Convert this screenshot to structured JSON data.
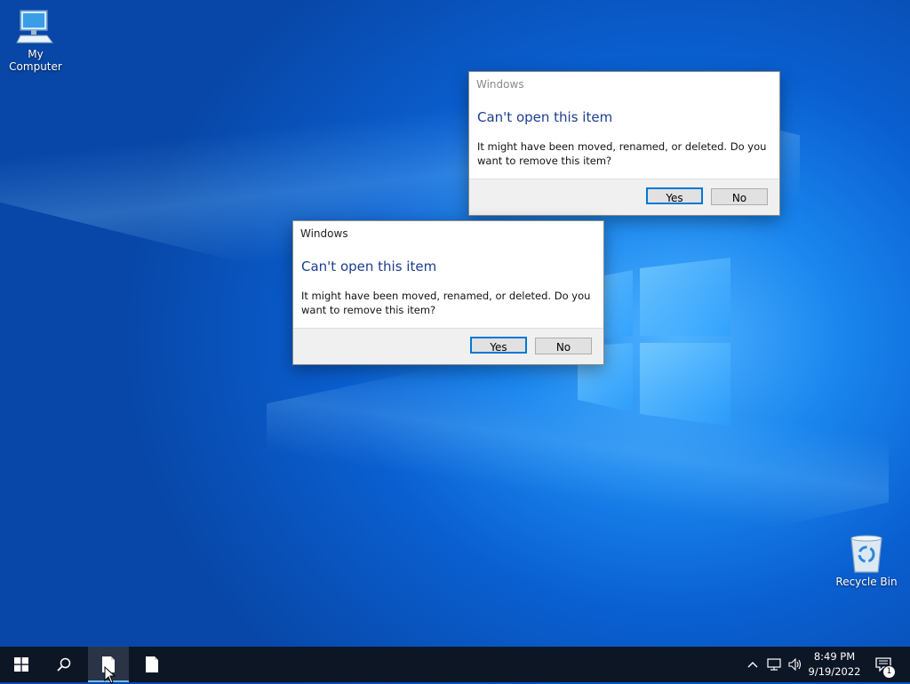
{
  "desktop": {
    "icons": [
      {
        "label": "My Computer",
        "icon": "computer-icon"
      },
      {
        "label": "Recycle Bin",
        "icon": "recycle-bin-icon"
      }
    ]
  },
  "dialogs": [
    {
      "title": "Windows",
      "heading": "Can't open this item",
      "message": "It might have been moved, renamed, or deleted. Do you want to remove this item?",
      "yes_label": "Yes",
      "no_label": "No",
      "state": "inactive"
    },
    {
      "title": "Windows",
      "heading": "Can't open this item",
      "message": "It might have been moved, renamed, or deleted. Do you want to remove this item?",
      "yes_label": "Yes",
      "no_label": "No",
      "state": "active"
    }
  ],
  "taskbar": {
    "apps": [
      {
        "icon": "document-icon",
        "active": true
      },
      {
        "icon": "document-icon",
        "active": false
      }
    ],
    "clock": {
      "time": "8:49 PM",
      "date": "9/19/2022"
    },
    "notifications_count": "1"
  },
  "colors": {
    "accent": "#0078d7",
    "heading": "#1e3d8f",
    "taskbar": "#0d1625"
  }
}
